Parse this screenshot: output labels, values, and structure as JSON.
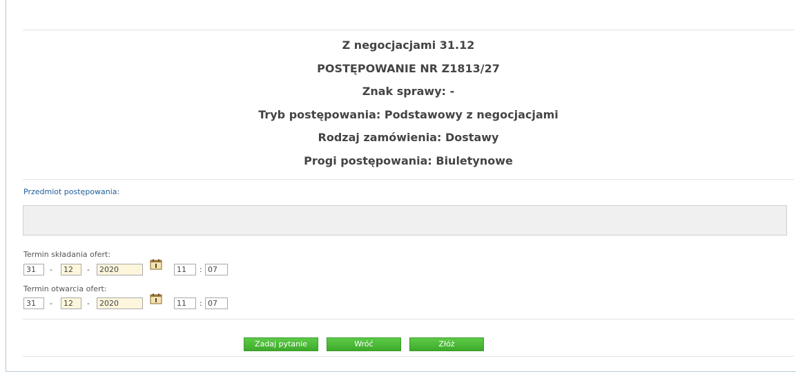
{
  "header": {
    "title": "Z negocjacjami 31.12",
    "proceeding_number": "POSTĘPOWANIE NR Z1813/27",
    "case_sign": "Znak sprawy: -",
    "procedure_mode": "Tryb postępowania: Podstawowy z negocjacjami",
    "order_type": "Rodzaj zamówienia: Dostawy",
    "thresholds": "Progi postępowania: Biuletynowe"
  },
  "subject": {
    "label": "Przedmiot postępowania:",
    "value": ""
  },
  "offer_deadline": {
    "label": "Termin składania ofert:",
    "day": "31",
    "month": "12",
    "year": "2020",
    "hour": "11",
    "minute": "07",
    "date_sep": "-",
    "time_sep": ":",
    "calendar_icon": "calendar-icon"
  },
  "opening_deadline": {
    "label": "Termin otwarcia ofert:",
    "day": "31",
    "month": "12",
    "year": "2020",
    "hour": "11",
    "minute": "07",
    "date_sep": "-",
    "time_sep": ":",
    "calendar_icon": "calendar-icon"
  },
  "actions": {
    "ask_label": "Zadaj pytanie",
    "back_label": "Wróć",
    "submit_label": "Złóż"
  },
  "colors": {
    "button_green": "#47b633",
    "label_blue": "#1f5c99",
    "field_bg": "#fdf6dc"
  }
}
